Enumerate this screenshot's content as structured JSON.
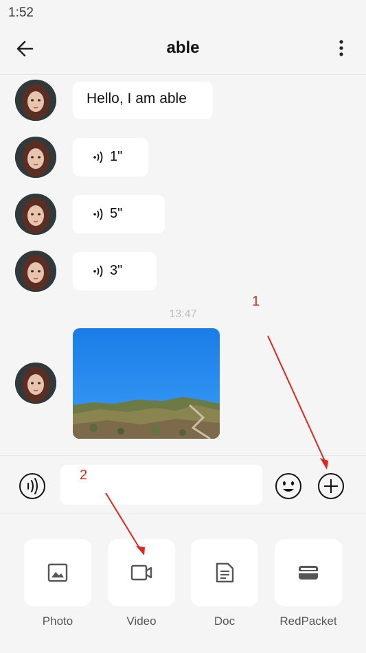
{
  "status": {
    "time": "1:52"
  },
  "header": {
    "title": "able"
  },
  "messages": [
    {
      "type": "text",
      "text": "Hello, I am able"
    },
    {
      "type": "voice",
      "duration": "1\""
    },
    {
      "type": "voice",
      "duration": "5\""
    },
    {
      "type": "voice",
      "duration": "3\""
    }
  ],
  "timestamp": "13:47",
  "input": {
    "placeholder": ""
  },
  "tools": [
    {
      "label": "Photo",
      "icon": "photo-icon"
    },
    {
      "label": "Video",
      "icon": "video-icon"
    },
    {
      "label": "Doc",
      "icon": "doc-icon"
    },
    {
      "label": "RedPacket",
      "icon": "red-packet-icon"
    }
  ],
  "annotations": {
    "one": "1",
    "two": "2"
  },
  "colors": {
    "background": "#f5f5f5",
    "annotation": "#e3261d",
    "sky": "#1e88f0"
  }
}
